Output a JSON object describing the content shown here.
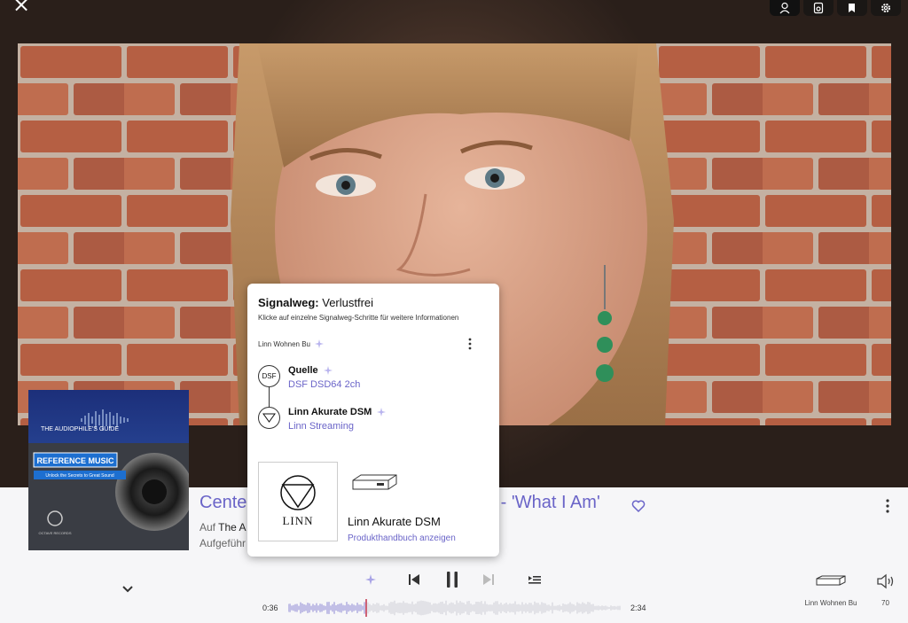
{
  "top_bar": {
    "close_glyph": "×",
    "icons": [
      "person-icon",
      "speaker-icon",
      "tag-icon",
      "gear-icon"
    ]
  },
  "popup": {
    "title_key": "Signalweg:",
    "title_value": "Verlustfrei",
    "subtitle": "Klicke auf einzelne Signalweg-Schritte für weitere Informationen",
    "zone": "Linn Wohnen Bu",
    "steps": [
      {
        "icon_text": "DSF",
        "name": "Quelle",
        "detail": "DSF DSD64 2ch"
      },
      {
        "icon_text": "",
        "name": "Linn Akurate DSM",
        "detail": "Linn Streaming"
      }
    ],
    "brand_logo": "LINN",
    "product_name": "Linn Akurate DSM",
    "product_link": "Produkthandbuch anzeigen"
  },
  "now_playing": {
    "title_start": "Cente",
    "title_end": "h - 'What I Am'",
    "album_prefix": "Auf",
    "album_name": "The A",
    "performed": "Aufgeführ",
    "album_art": {
      "banner": "THE AUDIOPHILE'S GUIDE",
      "title": "REFERENCE MUSIC",
      "subtitle": "Unlock the Secrets to Great Sound",
      "label": "OCTAVE RECORDS"
    }
  },
  "player": {
    "elapsed": "0:36",
    "duration": "2:34",
    "progress": 0.234,
    "device_label": "Linn Wohnen Bu",
    "volume": "70"
  },
  "colors": {
    "accent": "#6a64c8",
    "progress_marker": "#c0304a"
  }
}
